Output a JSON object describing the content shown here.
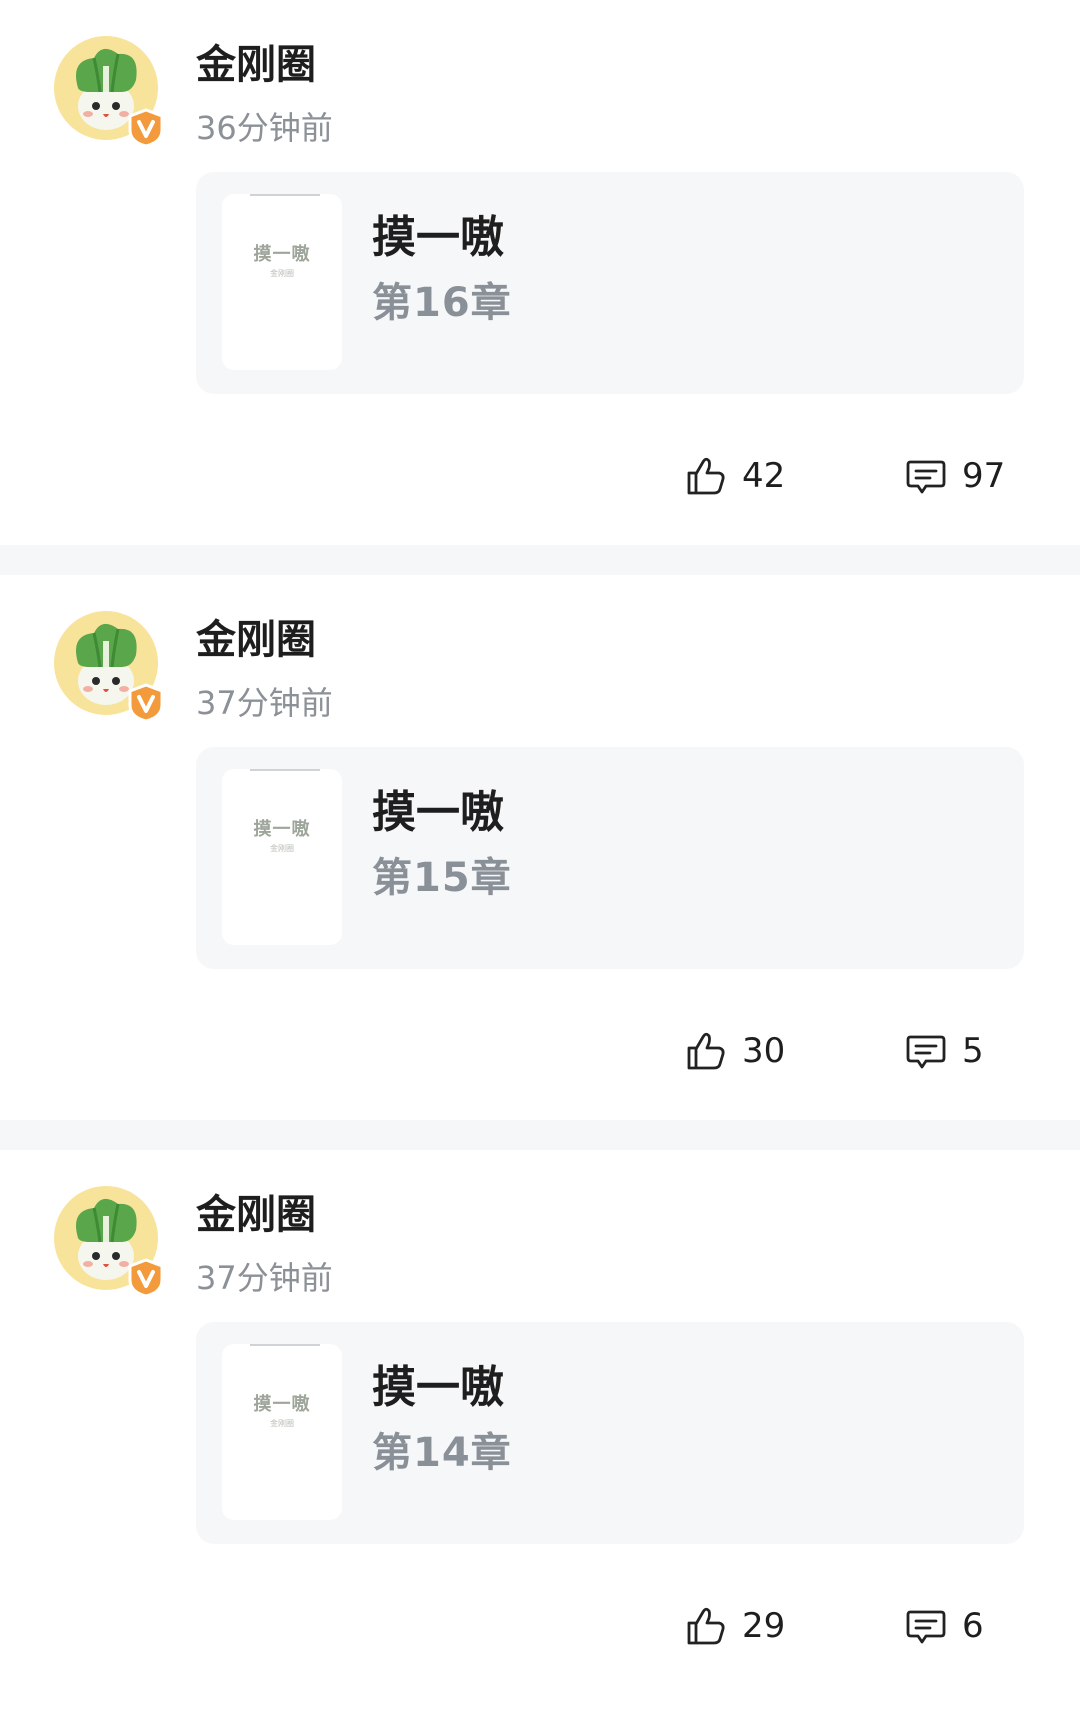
{
  "posts": [
    {
      "author": "金刚圈",
      "time": "36分钟前",
      "book": {
        "cover_title": "摸一嗷",
        "cover_subtitle": "金刚圈",
        "title": "摸一嗷",
        "chapter": "第16章"
      },
      "likes": "42",
      "comments": "97"
    },
    {
      "author": "金刚圈",
      "time": "37分钟前",
      "book": {
        "cover_title": "摸一嗷",
        "cover_subtitle": "金刚圈",
        "title": "摸一嗷",
        "chapter": "第15章"
      },
      "likes": "30",
      "comments": "5"
    },
    {
      "author": "金刚圈",
      "time": "37分钟前",
      "book": {
        "cover_title": "摸一嗷",
        "cover_subtitle": "金刚圈",
        "title": "摸一嗷",
        "chapter": "第14章"
      },
      "likes": "29",
      "comments": "6"
    }
  ],
  "icons": {
    "avatar": "cabbage-mascot-icon",
    "verified": "verified-v-badge-icon",
    "like": "thumbs-up-icon",
    "comment": "comment-bubble-icon"
  },
  "colors": {
    "verified_badge": "#f39a3c",
    "avatar_bg": "#f8e39a",
    "card_bg": "#f6f7f9",
    "divider": "#f6f7f9"
  }
}
